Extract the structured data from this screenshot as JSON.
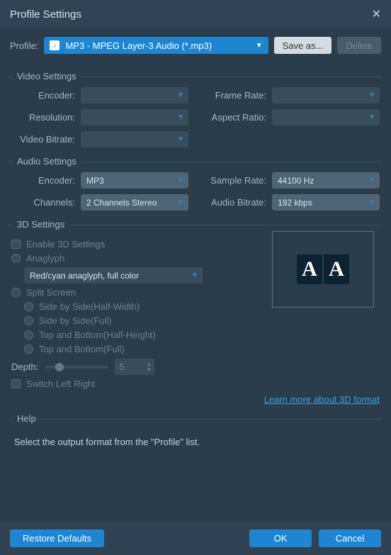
{
  "titlebar": {
    "title": "Profile Settings"
  },
  "profile": {
    "label": "Profile:",
    "value": "MP3 - MPEG Layer-3 Audio (*.mp3)",
    "saveas": "Save as...",
    "delete": "Delete"
  },
  "video": {
    "legend": "Video Settings",
    "encoder": "Encoder:",
    "resolution": "Resolution:",
    "bitrate": "Video Bitrate:",
    "framerate": "Frame Rate:",
    "aspect": "Aspect Ratio:"
  },
  "audio": {
    "legend": "Audio Settings",
    "encoder_l": "Encoder:",
    "encoder_v": "MP3",
    "channels_l": "Channels:",
    "channels_v": "2 Channels Stereo",
    "sample_l": "Sample Rate:",
    "sample_v": "44100 Hz",
    "abit_l": "Audio Bitrate:",
    "abit_v": "192 kbps"
  },
  "threeD": {
    "legend": "3D Settings",
    "enable": "Enable 3D Settings",
    "anaglyph": "Anaglyph",
    "anaglyph_combo": "Red/cyan anaglyph, full color",
    "split": "Split Screen",
    "sbs_half": "Side by Side(Half-Width)",
    "sbs_full": "Side by Side(Full)",
    "tab_half": "Top and Bottom(Half-Height)",
    "tab_full": "Top and Bottom(Full)",
    "depth_l": "Depth:",
    "depth_v": "5",
    "switch": "Switch Left Right",
    "link": "Learn more about 3D format"
  },
  "help": {
    "legend": "Help",
    "text": "Select the output format from the \"Profile\" list."
  },
  "footer": {
    "restore": "Restore Defaults",
    "ok": "OK",
    "cancel": "Cancel"
  }
}
